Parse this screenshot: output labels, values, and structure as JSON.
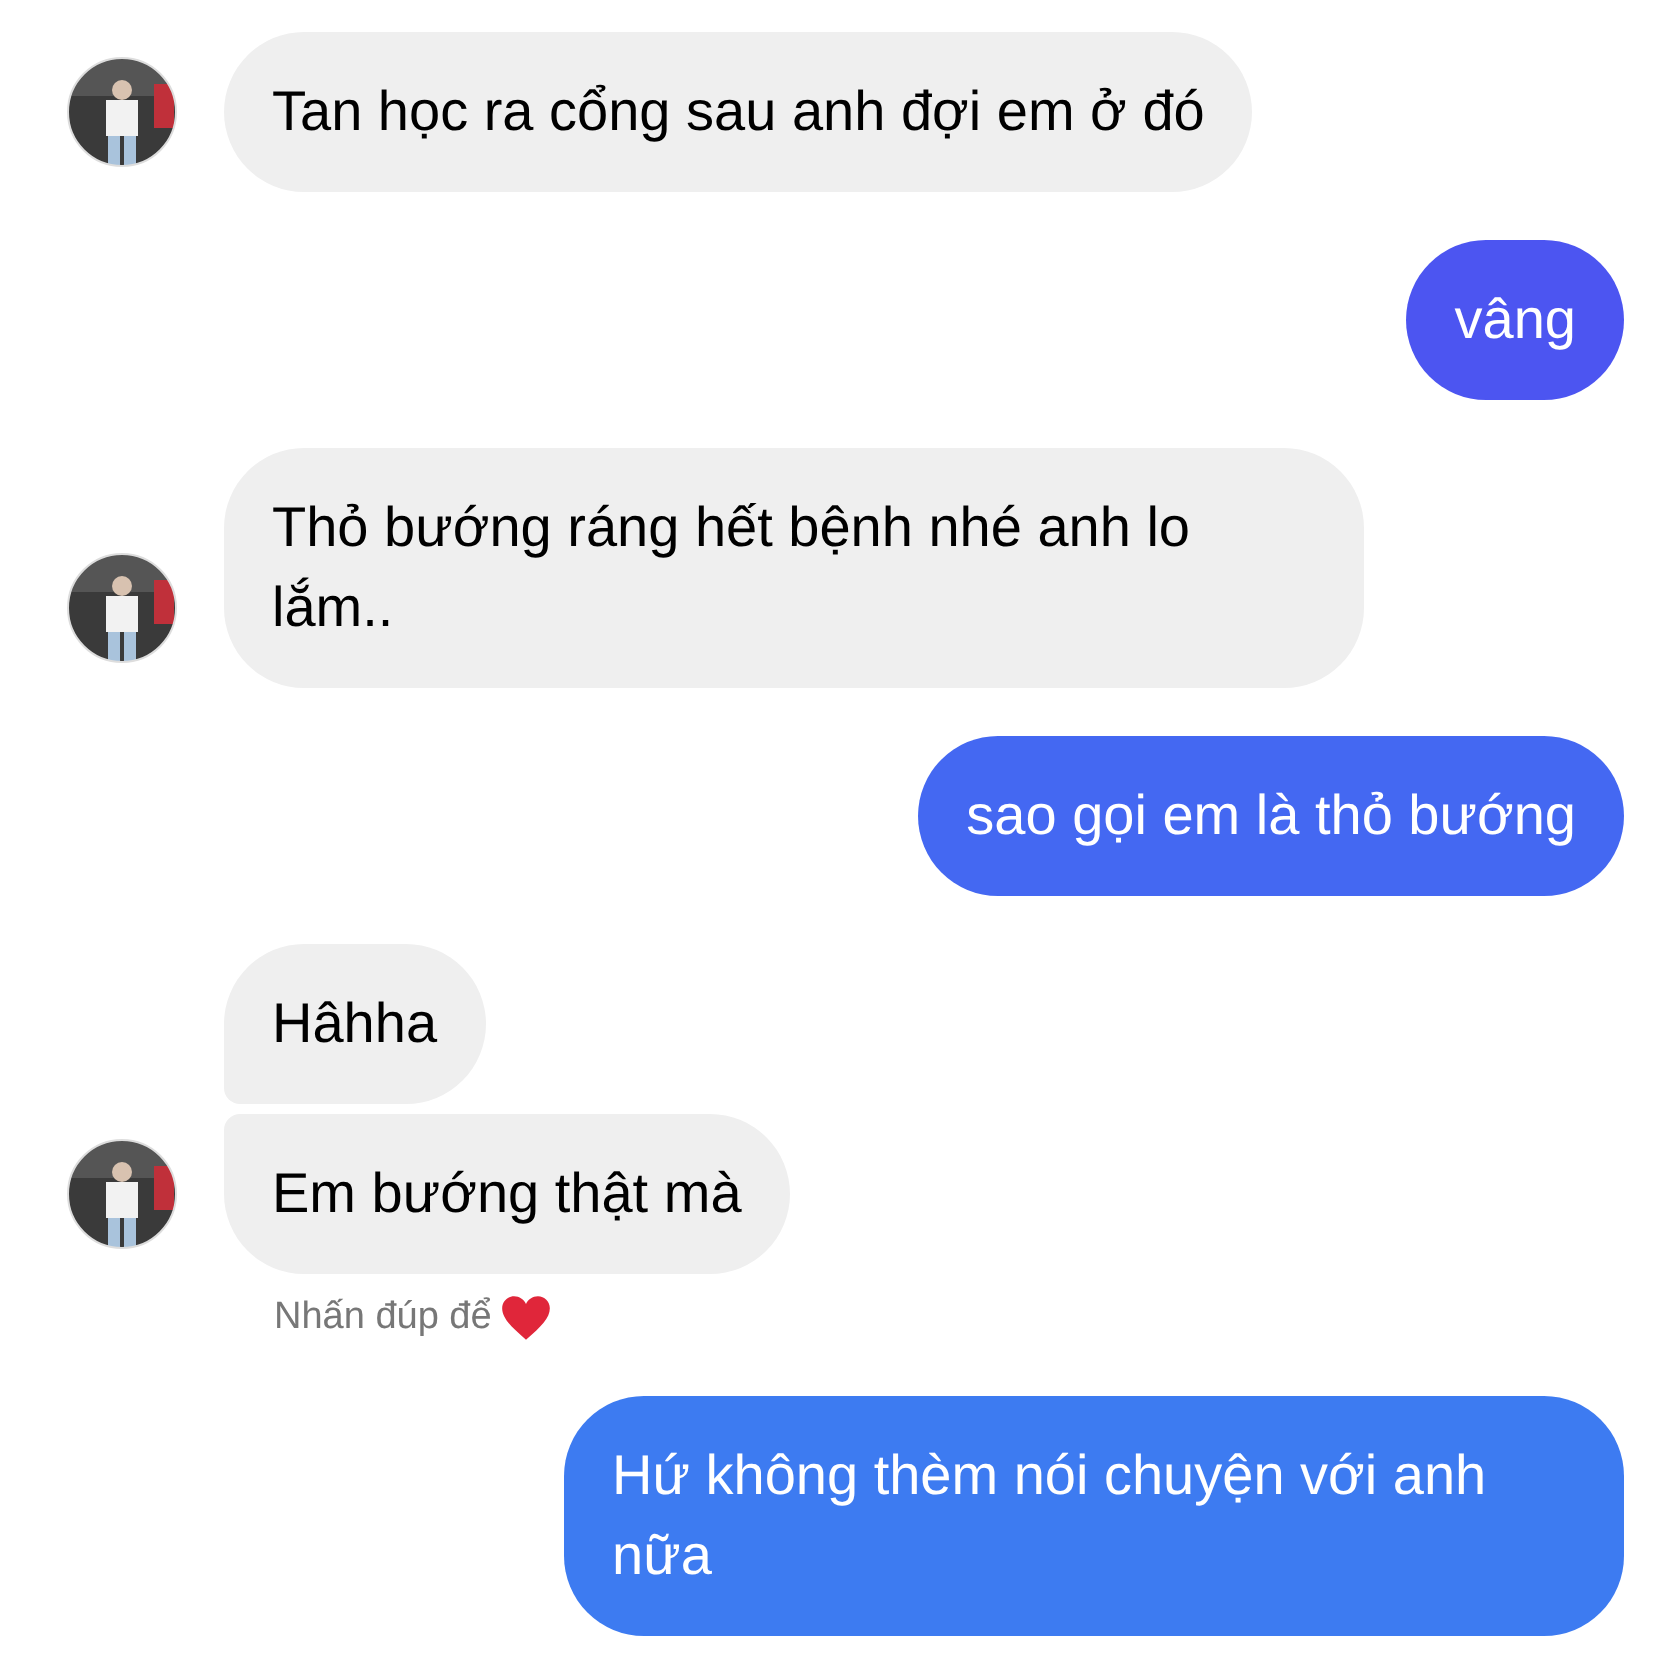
{
  "messages": [
    {
      "kind": "received",
      "text": "Tan học ra cổng sau anh đợi em ở đó",
      "show_avatar": true
    },
    {
      "kind": "sent",
      "text": "vâng",
      "color": "#4c55f1"
    },
    {
      "kind": "received",
      "text": "Thỏ bướng ráng hết bệnh nhé anh lo lắm..",
      "show_avatar": true
    },
    {
      "kind": "sent",
      "text": "sao gọi em là thỏ bướng",
      "color": "#4468f2"
    },
    {
      "kind": "received",
      "text": "Hâhha",
      "show_avatar": false
    },
    {
      "kind": "received",
      "text": "Em bướng thật mà",
      "show_avatar": true,
      "hint": "Nhấn đúp để"
    },
    {
      "kind": "sent",
      "text": "Hứ không thèm nói chuyện với anh nữa",
      "color": "#3d7bf1"
    }
  ]
}
